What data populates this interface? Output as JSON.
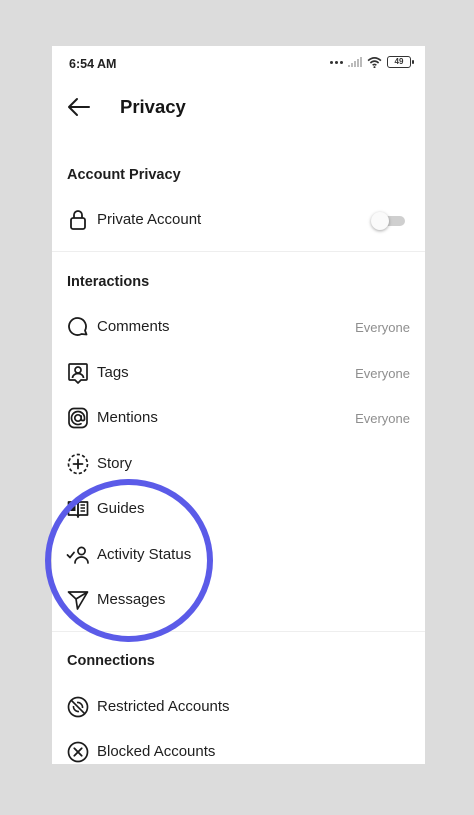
{
  "status_bar": {
    "time": "6:54 AM",
    "battery": "49"
  },
  "header": {
    "title": "Privacy"
  },
  "account_privacy": {
    "title": "Account Privacy",
    "private_account": {
      "label": "Private Account",
      "toggle_on": false
    }
  },
  "interactions": {
    "title": "Interactions",
    "items": [
      {
        "label": "Comments",
        "value": "Everyone",
        "icon": "comment-icon"
      },
      {
        "label": "Tags",
        "value": "Everyone",
        "icon": "tag-icon"
      },
      {
        "label": "Mentions",
        "value": "Everyone",
        "icon": "at-icon"
      },
      {
        "label": "Story",
        "value": "",
        "icon": "story-add-icon"
      },
      {
        "label": "Guides",
        "value": "",
        "icon": "guides-icon"
      },
      {
        "label": "Activity Status",
        "value": "",
        "icon": "activity-status-icon"
      },
      {
        "label": "Messages",
        "value": "",
        "icon": "send-icon"
      }
    ]
  },
  "connections": {
    "title": "Connections",
    "items": [
      {
        "label": "Restricted Accounts",
        "icon": "restricted-icon"
      },
      {
        "label": "Blocked Accounts",
        "icon": "blocked-icon"
      }
    ]
  },
  "colors": {
    "highlight": "#5b5be8",
    "secondary_text": "#8e8e8e"
  }
}
